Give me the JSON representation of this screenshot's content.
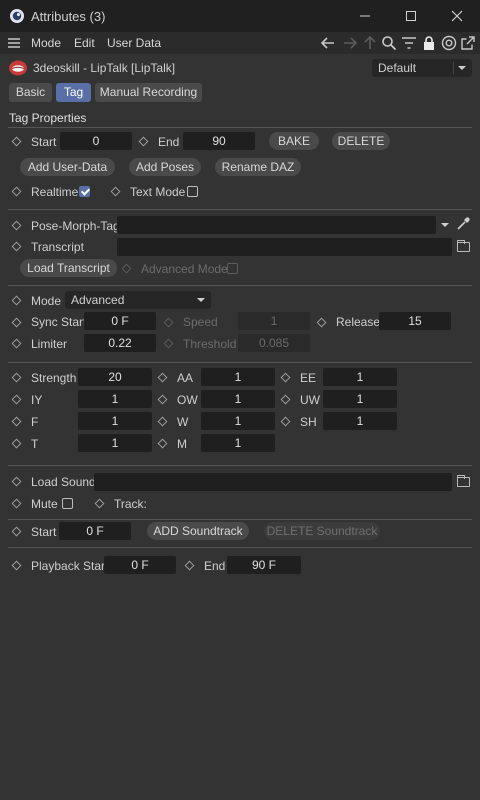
{
  "window": {
    "title": "Attributes (3)"
  },
  "menu": {
    "mode": "Mode",
    "edit": "Edit",
    "user_data": "User Data"
  },
  "object": {
    "name": "3deoskill - LipTalk [LipTalk]",
    "preset": "Default"
  },
  "tabs": {
    "basic": "Basic",
    "tag": "Tag",
    "manual_recording": "Manual Recording"
  },
  "section": {
    "title": "Tag Properties"
  },
  "row_start": {
    "start_label": "Start",
    "start_value": "0",
    "end_label": "End",
    "end_value": "90",
    "bake": "BAKE",
    "delete": "DELETE"
  },
  "row_buttons": {
    "add_user_data": "Add User-Data",
    "add_poses": "Add Poses",
    "rename_daz": "Rename DAZ"
  },
  "row_modes": {
    "realtime_label": "Realtime",
    "realtime_checked": true,
    "text_mode_label": "Text Mode",
    "text_mode_checked": false
  },
  "pose_morph": {
    "label": "Pose-Morph-Tag",
    "value": ""
  },
  "transcript": {
    "label": "Transcript",
    "value": "",
    "load_button": "Load Transcript",
    "advanced_label": "Advanced Mode",
    "advanced_checked": false
  },
  "mode_row": {
    "label": "Mode",
    "value": "Advanced"
  },
  "sync_row": {
    "sync_label": "Sync Start",
    "sync_value": "0 F",
    "speed_label": "Speed",
    "speed_value": "1",
    "release_label": "Release",
    "release_value": "15"
  },
  "limiter_row": {
    "limiter_label": "Limiter",
    "limiter_value": "0.22",
    "threshold_label": "Threshold",
    "threshold_value": "0.085"
  },
  "phonemes": {
    "strength_label": "Strength",
    "strength_value": "20",
    "aa_label": "AA",
    "aa_value": "1",
    "ee_label": "EE",
    "ee_value": "1",
    "iy_label": "IY",
    "iy_value": "1",
    "ow_label": "OW",
    "ow_value": "1",
    "uw_label": "UW",
    "uw_value": "1",
    "f_label": "F",
    "f_value": "1",
    "w_label": "W",
    "w_value": "1",
    "sh_label": "SH",
    "sh_value": "1",
    "t_label": "T",
    "t_value": "1",
    "m_label": "M",
    "m_value": "1"
  },
  "sound": {
    "load_label": "Load Sound",
    "value": "",
    "mute_label": "Mute",
    "mute_checked": false,
    "track_label": "Track:"
  },
  "soundtrack_row": {
    "start_label": "Start",
    "start_value": "0 F",
    "add_button": "ADD Soundtrack",
    "delete_button": "DELETE Soundtrack"
  },
  "playback_row": {
    "start_label": "Playback Start",
    "start_value": "0 F",
    "end_label": "End",
    "end_value": "90 F"
  },
  "colors": {
    "accent": "#5a6fa8",
    "panel": "#333333",
    "field": "#1f1f1f",
    "button": "#4a4a4a"
  }
}
